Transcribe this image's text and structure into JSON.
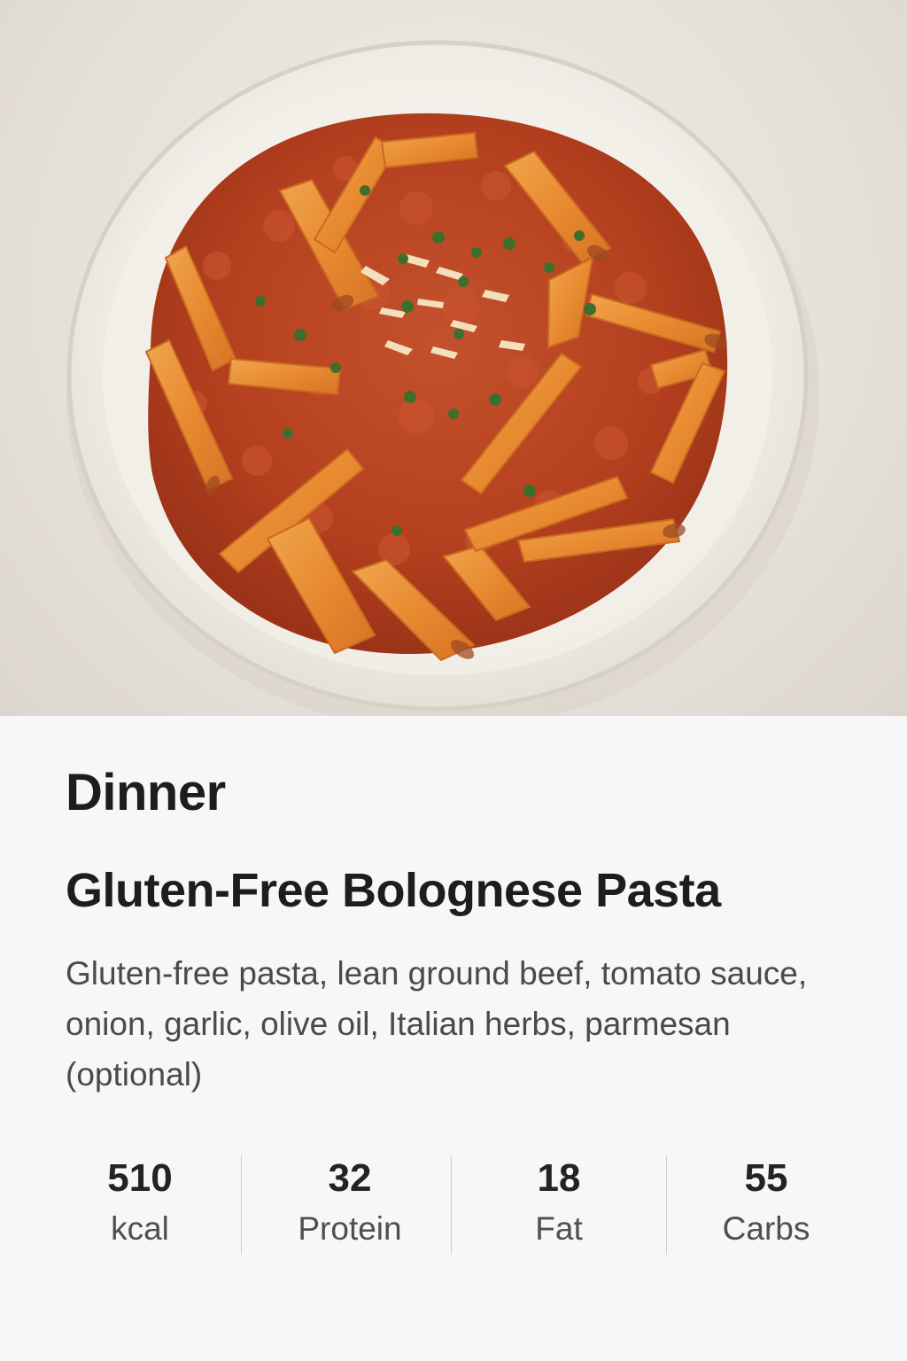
{
  "meal_type": "Dinner",
  "recipe_title": "Gluten-Free Bolognese Pasta",
  "ingredients": "Gluten-free pasta, lean ground beef, tomato sauce, onion, garlic, olive oil, Italian herbs, parmesan (optional)",
  "macros": [
    {
      "value": "510",
      "label": "kcal"
    },
    {
      "value": "32",
      "label": "Protein"
    },
    {
      "value": "18",
      "label": "Fat"
    },
    {
      "value": "55",
      "label": "Carbs"
    }
  ],
  "colors": {
    "background": "#f7f7f7",
    "text_primary": "#1d1d1d",
    "text_secondary": "#4a4a4a",
    "divider": "#cfcfcf"
  }
}
